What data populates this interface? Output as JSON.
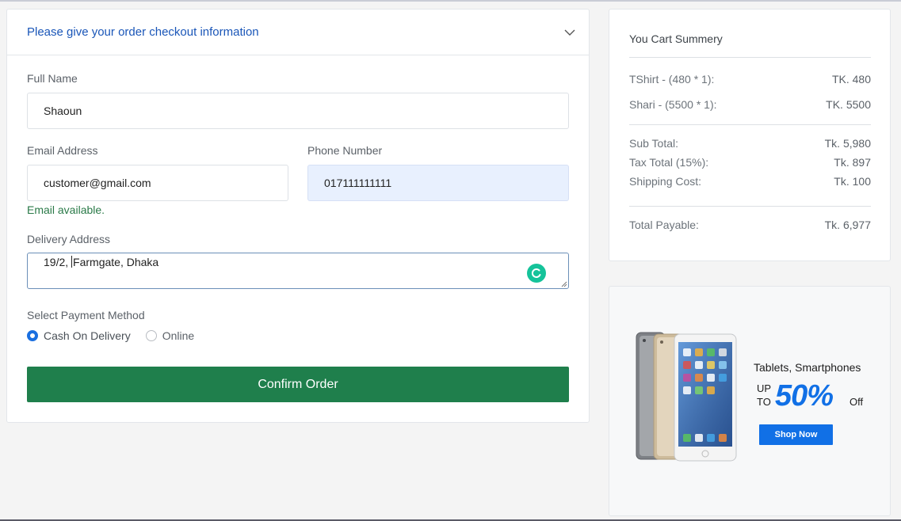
{
  "checkout": {
    "title": "Please give your order checkout information",
    "full_name": {
      "label": "Full Name",
      "value": "Shaoun"
    },
    "email": {
      "label": "Email Address",
      "value": "customer@gmail.com",
      "status": "Email available."
    },
    "phone": {
      "label": "Phone Number",
      "value": "017111111111"
    },
    "address": {
      "label": "Delivery Address",
      "value_before_caret": "19/2, ",
      "value_after_caret": "Farmgate, Dhaka"
    },
    "payment": {
      "label": "Select Payment Method",
      "options": [
        {
          "label": "Cash On Delivery",
          "selected": true
        },
        {
          "label": "Online",
          "selected": false
        }
      ]
    },
    "confirm_label": "Confirm Order",
    "colors": {
      "title": "#1a56b8",
      "confirm": "#1f7f4c",
      "status": "#2a7a48"
    }
  },
  "cart": {
    "title": "You Cart Summery",
    "items": [
      {
        "name": "TShirt - (480 * 1):",
        "price": "TK. 480"
      },
      {
        "name": "Shari - (5500 * 1):",
        "price": "TK. 5500"
      }
    ],
    "sub_total": {
      "label": "Sub Total:",
      "value": "Tk. 5,980"
    },
    "tax_total": {
      "label": "Tax Total (15%):",
      "value": "Tk. 897"
    },
    "shipping": {
      "label": "Shipping Cost:",
      "value": "Tk. 100"
    },
    "total": {
      "label": "Total Payable:",
      "value": "Tk. 6,977"
    }
  },
  "ad": {
    "title": "Tablets, Smartphones",
    "up": "UP",
    "to": "TO",
    "percent": "50%",
    "off": "Off",
    "shop_label": "Shop Now",
    "accent": "#1170e6"
  }
}
